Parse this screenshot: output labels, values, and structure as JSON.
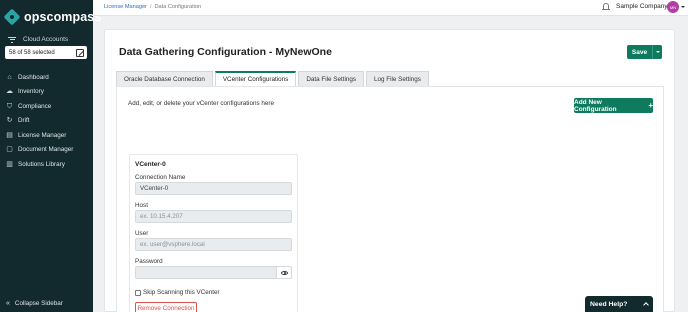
{
  "brand": {
    "name": "opscompass"
  },
  "sidebar": {
    "cloud_accounts_label": "Cloud Accounts",
    "selected_text": "58 of 58 selected",
    "items": [
      {
        "label": "Dashboard",
        "icon": "home-icon"
      },
      {
        "label": "Inventory",
        "icon": "cloud-icon"
      },
      {
        "label": "Compliance",
        "icon": "shield-icon"
      },
      {
        "label": "Drift",
        "icon": "refresh-icon"
      },
      {
        "label": "License Manager",
        "icon": "document-icon"
      },
      {
        "label": "Document Manager",
        "icon": "file-icon"
      },
      {
        "label": "Solutions Library",
        "icon": "book-icon"
      }
    ],
    "collapse_label": "Collapse Sidebar"
  },
  "header": {
    "breadcrumb": [
      "License Manager",
      "Data Configuration"
    ],
    "company": "Sample Company",
    "avatar_initials": "MN"
  },
  "main": {
    "title": "Data Gathering Configuration - MyNewOne",
    "save_label": "Save",
    "tabs": [
      {
        "label": "Oracle Database Connection",
        "active": false
      },
      {
        "label": "VCenter Configurations",
        "active": true
      },
      {
        "label": "Data File Settings",
        "active": false
      },
      {
        "label": "Log File Settings",
        "active": false
      }
    ],
    "panel_description": "Add, edit, or delete your vCenter configurations here",
    "add_button_label": "Add New Configuration",
    "vcenter": {
      "title": "VCenter-0",
      "connection_name_label": "Connection Name",
      "connection_name_value": "VCenter-0",
      "host_label": "Host",
      "host_placeholder": "ex. 10.15.4.207",
      "user_label": "User",
      "user_placeholder": "ex. user@vsphere.local",
      "password_label": "Password",
      "skip_label": "Skip Scanning this VCenter",
      "remove_label": "Remove Connection"
    }
  },
  "help": {
    "label": "Need Help?"
  },
  "colors": {
    "sidebar_bg": "#12292e",
    "accent": "#0e7a5e",
    "danger": "#d9534f",
    "avatar": "#b23fa5"
  }
}
